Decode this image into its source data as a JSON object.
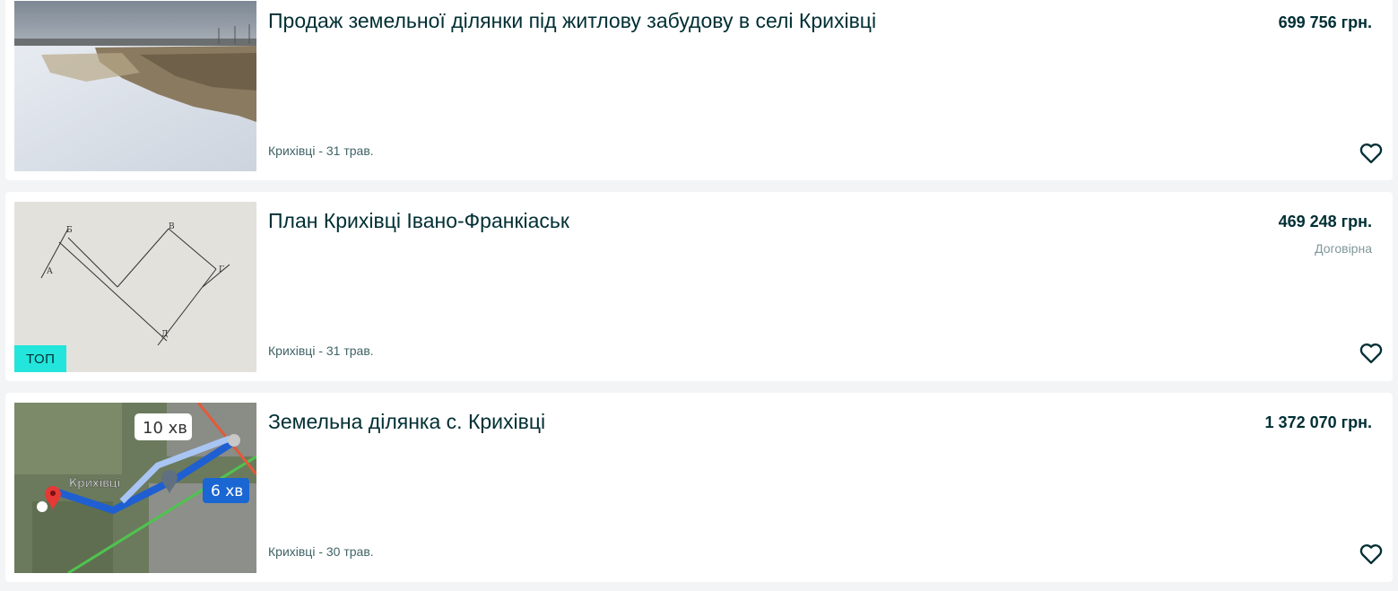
{
  "colors": {
    "page_background": "#f2f4f5",
    "card_background": "#ffffff",
    "text_primary": "#002f34",
    "text_secondary": "#406367",
    "text_muted": "#7f9799",
    "top_badge": "#23e5db"
  },
  "listings": [
    {
      "title": "Продаж земельної ділянки під житлову забудову в селі Крихівці",
      "price": "699 756 грн.",
      "location_date": "Крихівці - 31 трав.",
      "image": "snowy-field-photo",
      "favorite_icon": "heart-outline-icon"
    },
    {
      "title": "План Крихівці Івано-Франкіаськ",
      "price": "469 248 грн.",
      "negotiable": "Договірна",
      "location_date": "Крихівці - 31 трав.",
      "badge": "ТОП",
      "image": "land-plot-plan-drawing",
      "plan_labels": [
        "Б",
        "В",
        "А",
        "Г",
        "Д"
      ],
      "favorite_icon": "heart-outline-icon"
    },
    {
      "title": "Земельна ділянка с. Крихівці",
      "price": "1 372 070 грн.",
      "location_date": "Крихівці - 30 трав.",
      "image": "route-map-screenshot",
      "map_labels": {
        "time_alt": "10 хв",
        "time_main": "6 хв",
        "place": "Крихівці"
      },
      "favorite_icon": "heart-outline-icon"
    }
  ]
}
